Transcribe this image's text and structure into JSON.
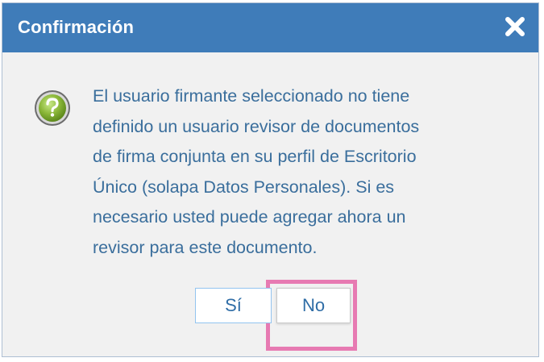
{
  "dialog": {
    "title": "Confirmación",
    "message_lines": [
      "El usuario firmante seleccionado no tiene",
      "definido un usuario revisor de documentos",
      "de firma conjunta en su perfil de Escritorio",
      "Único (solapa Datos Personales). Si es",
      "necesario usted puede agregar ahora un",
      "revisor para este documento."
    ],
    "icon": "question-icon",
    "close_icon": "close-icon"
  },
  "buttons": {
    "yes_label": "Sí",
    "no_label": "No"
  },
  "colors": {
    "titlebar": "#3f7cb9",
    "message_text": "#3a6e9c",
    "highlight": "#e77ab2",
    "icon_green": "#8cb83a"
  }
}
